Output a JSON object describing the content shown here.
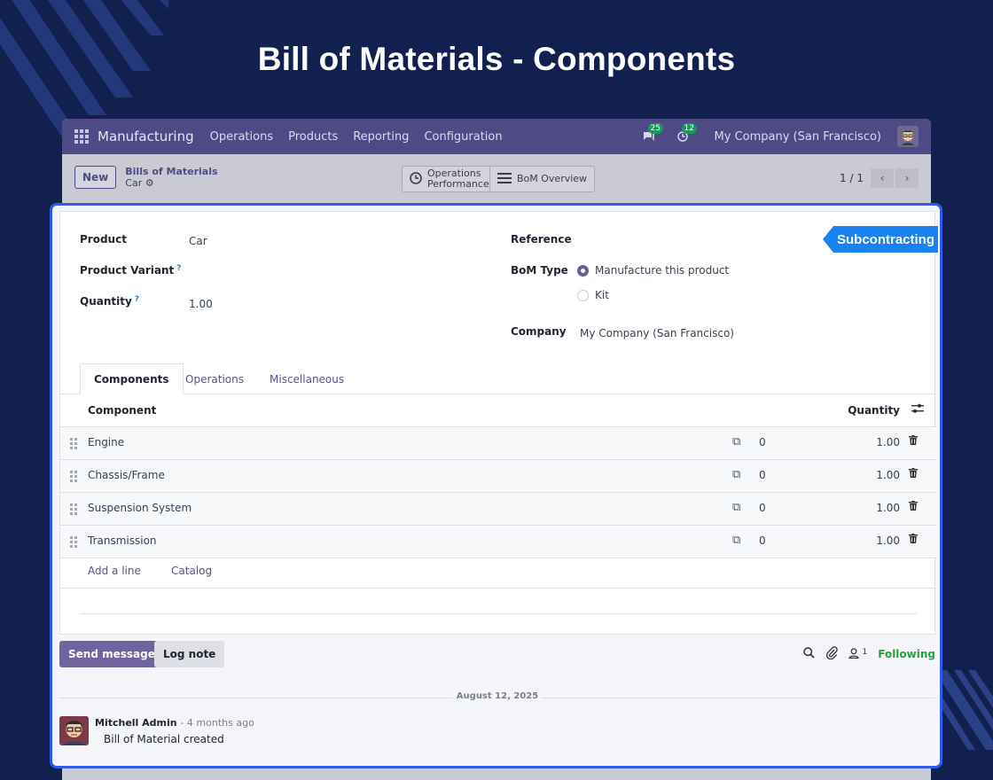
{
  "page_title": "Bill of Materials - Components",
  "navbar": {
    "brand": "Manufacturing",
    "menus": [
      "Operations",
      "Products",
      "Reporting",
      "Configuration"
    ],
    "messages_count": "25",
    "activities_count": "12",
    "company": "My Company (San Francisco)"
  },
  "controlbar": {
    "new_label": "New",
    "breadcrumb_parent": "Bills of Materials",
    "breadcrumb_current": "Car",
    "smart_buttons": [
      {
        "label": "Operations Performance",
        "icon": "clock-icon"
      },
      {
        "label": "BoM Overview",
        "icon": "list-icon"
      }
    ],
    "pager": "1 / 1"
  },
  "form": {
    "ribbon": "Subcontracting",
    "product_label": "Product",
    "product_value": "Car",
    "variant_label": "Product Variant",
    "quantity_label": "Quantity",
    "quantity_value": "1.00",
    "help_mark": "?",
    "reference_label": "Reference",
    "bom_type_label": "BoM Type",
    "bom_type_options": [
      {
        "label": "Manufacture this product",
        "selected": true
      },
      {
        "label": "Kit",
        "selected": false
      }
    ],
    "company_label": "Company",
    "company_value": "My Company (San Francisco)"
  },
  "tabs": [
    "Components",
    "Operations",
    "Miscellaneous"
  ],
  "table": {
    "col_component": "Component",
    "col_quantity": "Quantity",
    "rows": [
      {
        "name": "Engine",
        "zero": "0",
        "qty": "1.00"
      },
      {
        "name": "Chassis/Frame",
        "zero": "0",
        "qty": "1.00"
      },
      {
        "name": "Suspension System",
        "zero": "0",
        "qty": "1.00"
      },
      {
        "name": "Transmission",
        "zero": "0",
        "qty": "1.00"
      }
    ],
    "add_line": "Add a line",
    "catalog": "Catalog"
  },
  "chatter": {
    "send_message": "Send message",
    "log_note": "Log note",
    "followers_count": "1",
    "following": "Following",
    "date": "August 12, 2025",
    "message": {
      "author": "Mitchell Admin",
      "time": "- 4 months ago",
      "body": "Bill of Material created"
    }
  },
  "colors": {
    "accent": "#71639e",
    "highlight_border": "#2f5bea",
    "ribbon": "#1a82f0",
    "following": "#22a33a"
  }
}
